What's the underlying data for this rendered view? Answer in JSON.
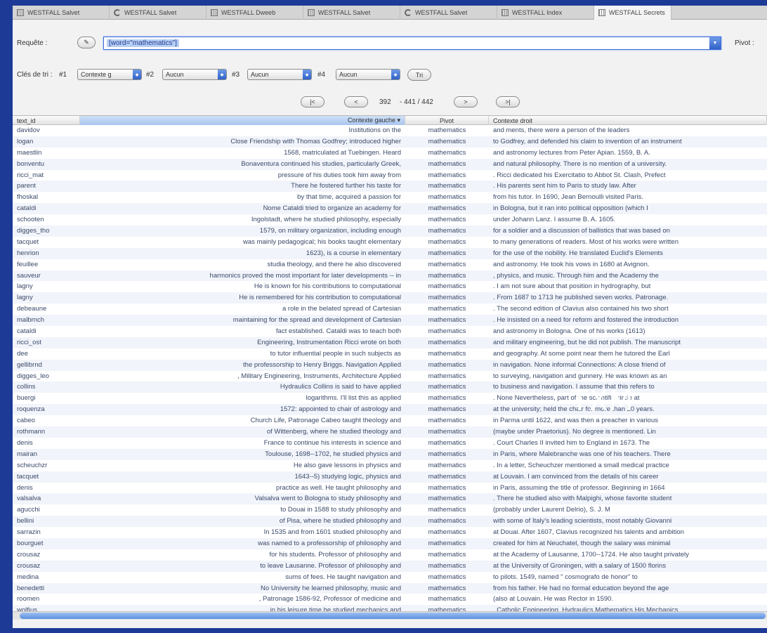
{
  "tabs": [
    {
      "label": "WESTFALL Salvet",
      "icon": "grid"
    },
    {
      "label": "WESTFALL Salvet",
      "icon": "concordance"
    },
    {
      "label": "WESTFALL Dweeb",
      "icon": "grid"
    },
    {
      "label": "WESTFALL Salvet",
      "icon": "grid"
    },
    {
      "label": "WESTFALL Salvet",
      "icon": "concordance"
    },
    {
      "label": "WESTFALL Index",
      "icon": "grid"
    },
    {
      "label": "WESTFALL Secrets",
      "icon": "grid"
    }
  ],
  "query": {
    "label": "Requête :",
    "value": "[word=\"mathematics\"]",
    "pivot_label": "Pivot :"
  },
  "sort": {
    "label": "Clés de tri :",
    "k1": "#1",
    "s1": "Contexte g",
    "k2": "#2",
    "s2": "Aucun",
    "k3": "#3",
    "s3": "Aucun",
    "k4": "#4",
    "s4": "Aucun",
    "button": "Tri"
  },
  "pagination": {
    "first": "|<",
    "prev": "<",
    "current": "392",
    "range": "- 441 / 442",
    "next": ">",
    "last": ">|"
  },
  "table": {
    "headers": [
      "text_id",
      "Contexte gauche ▾",
      "Pivot",
      "Contexte droit"
    ],
    "rows": [
      [
        "davidov",
        "Institutions on the",
        "mathematics",
        "and ments, there were a person of the leaders"
      ],
      [
        "logan",
        "Close Friendship with Thomas Godfrey; introduced higher",
        "mathematics",
        "to Godfrey, and defended his claim to invention of an instrument"
      ],
      [
        "maestlin",
        "1568, matriculated at Tuebingen. Heard",
        "mathematics",
        "and astronomy lectures from Peter Apian. 1559, B. A."
      ],
      [
        "bonventu",
        "Bonaventura continued his studies, particularly Greek,",
        "mathematics",
        "and natural philosophy. There is no mention of a university."
      ],
      [
        "ricci_mat",
        "pressure of his duties took him away from",
        "mathematics",
        ". Ricci dedicated his Exercitatio to Abbot St. Clash, Prefect"
      ],
      [
        "parent",
        "There he fostered further his taste for",
        "mathematics",
        ". His parents sent him to Paris to study law. After"
      ],
      [
        "fhoskal",
        "by that time, acquired a passion for",
        "mathematics",
        "from his tutor. In 1690, Jean Bernoulli visited Paris."
      ],
      [
        "cataldi",
        "Nome Cataldi tried to organize an academy for",
        "mathematics",
        "in Bologna, but it ran into political opposition (which I"
      ],
      [
        "schooten",
        "Ingolstadt, where he studied philosophy, especially",
        "mathematics",
        "under Johann Lanz. I assume B. A. 1605."
      ],
      [
        "digges_tho",
        "1579, on military organization, including enough",
        "mathematics",
        "for a soldier and a discussion of ballistics that was based on"
      ],
      [
        "tacquet",
        "was mainly pedagogical; his books taught elementary",
        "mathematics",
        "to many generations of readers. Most of his works were written"
      ],
      [
        "henrion",
        "1623), is a course in elementary",
        "mathematics",
        "for the use of the nobility. He translated Euclid's Elements"
      ],
      [
        "feuillee",
        "studia theology, and there he also discovered",
        "mathematics",
        "and astronomy. He took his vows in 1680 at Avignon."
      ],
      [
        "sauveur",
        "harmonics proved the most important for later developments -- in",
        "mathematics",
        ", physics, and music. Through him and the Academy the"
      ],
      [
        "lagny",
        "He is known for his contributions to computational",
        "mathematics",
        ". I am not sure about that position in hydrography, but"
      ],
      [
        "lagny",
        "He is remembered for his contribution to computational",
        "mathematics",
        ". From 1687 to 1713 he published seven works. Patronage."
      ],
      [
        "debeaune",
        "a role in the belated spread of Cartesian",
        "mathematics",
        ". The second edition of Clavius also contained his two short"
      ],
      [
        "malbrnch",
        "maintaining for the spread and development of Cartesian",
        "mathematics",
        ". He insisted on a need for reform and fostered the introduction"
      ],
      [
        "cataldi",
        "fact established. Cataldi was to teach both",
        "mathematics",
        "and astronomy in Bologna. One of his works (1613)"
      ],
      [
        "ricci_ost",
        "Engineering, Instrumentation Ricci wrote on both",
        "mathematics",
        "and military engineering, but he did not publish. The manuscript"
      ],
      [
        "dee",
        "to tutor influential people in such subjects as",
        "mathematics",
        "and geography. At some point near them he tutored the Earl"
      ],
      [
        "gellibrnd",
        "the professorship to Henry Briggs. Navigation Applied",
        "mathematics",
        "in navigation. None informal Connections: A close friend of"
      ],
      [
        "digges_leo",
        ", Military Engineering, Instruments, Architecture Applied",
        "mathematics",
        "to surveying, navigation and gunnery. He was known as an"
      ],
      [
        "collins",
        "Hydraulics Collins is said to have applied",
        "mathematics",
        "to business and navigation. I assume that this refers to"
      ],
      [
        "buergi",
        "logarithms. I'll list this as applied",
        "mathematics",
        ". None Nevertheless, part of the scientific circle at"
      ],
      [
        "roquenza",
        "1572: appointed to chair of astrology and",
        "mathematics",
        "at the university; held the chair for more than 20 years."
      ],
      [
        "cabeo",
        "Church Life, Patronage Cabeo taught theology and",
        "mathematics",
        "in Parma until 1622, and was then a preacher in various"
      ],
      [
        "rothmann",
        "of Wittenberg, where he studied theology and",
        "mathematics",
        "(maybe under Praetorius). No degree is mentioned. Lin"
      ],
      [
        "denis",
        "France to continue his interests in science and",
        "mathematics",
        ". Court Charles II invited him to England in 1673. The"
      ],
      [
        "mairan",
        "Toulouse, 1698--1702, he studied physics and",
        "mathematics",
        "in Paris, where Malebranche was one of his teachers. There"
      ],
      [
        "scheuchzr",
        "He also gave lessons in physics and",
        "mathematics",
        ". In a letter, Scheuchzer mentioned a small medical practice"
      ],
      [
        "tacquet",
        "1643--5) studying logic, physics and",
        "mathematics",
        "at Louvain. I am convinced from the details of his career"
      ],
      [
        "denis",
        "practice as well. He taught philosophy and",
        "mathematics",
        "in Paris, assuming the title of professor. Beginning in 1664"
      ],
      [
        "valsalva",
        "Valsalva went to Bologna to study philosophy and",
        "mathematics",
        ". There he studied also with Malpighi, whose favorite student"
      ],
      [
        "agucchi",
        "to Douai in 1588 to study philosophy and",
        "mathematics",
        "(probably under Laurent Delrio), S. J. M"
      ],
      [
        "bellini",
        "of Pisa, where he studied philosophy and",
        "mathematics",
        "with some of Italy's leading scientists, most notably Giovanni"
      ],
      [
        "sarrazin",
        "In 1535 and from 1601 studied philosophy and",
        "mathematics",
        "at Douai. After 1607, Clavius recognized his talents and ambition"
      ],
      [
        "bourguet",
        "was named to a professorship of philosophy and",
        "mathematics",
        "created for him at Neuchatel, though the salary was minimal"
      ],
      [
        "crousaz",
        "for his students. Professor of philosophy and",
        "mathematics",
        "at the Academy of Lausanne, 1700--1724. He also taught privately"
      ],
      [
        "crousaz",
        "to leave Lausanne. Professor of philosophy and",
        "mathematics",
        "at the University of Groningen, with a salary of 1500 florins"
      ],
      [
        "medina",
        "sums of fees. He taught navigation and",
        "mathematics",
        "to pilots. 1549, named \" cosmografo de honor\" to"
      ],
      [
        "benedetti",
        "No University he learned philosophy, music and",
        "mathematics",
        "from his father. He had no formal education beyond the age"
      ],
      [
        "roomen",
        ", Patronage 1586-92, Professor of medicine and",
        "mathematics",
        "(also at Louvain. He was Rector in 1590."
      ],
      [
        "wolfius",
        "in his leisure time he studied mechanics and",
        "mathematics",
        ". Catholic Engineering, Hydraulics Mathematics His Mechanics"
      ]
    ]
  },
  "watermark": "TXM",
  "colors": {
    "background": "#1d3a96",
    "accent": "#3a6bd9",
    "sorted_header": "#a9c6ef",
    "scroll_thumb": "#5c8fe0"
  }
}
